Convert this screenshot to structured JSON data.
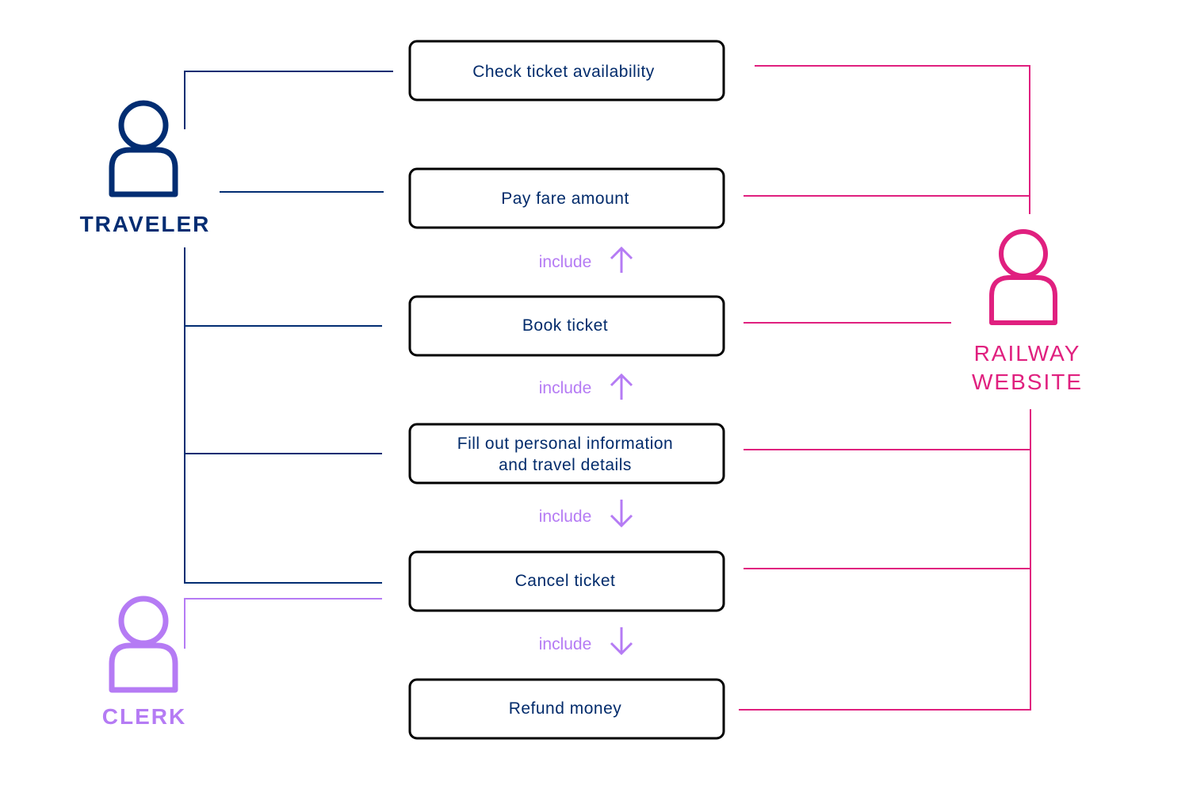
{
  "colors": {
    "traveler": "#022d72",
    "railway": "#e0207f",
    "clerk": "#b57bf4",
    "box_border": "#000000"
  },
  "actors": {
    "traveler": {
      "label": "TRAVELER",
      "icon": "person-icon"
    },
    "clerk": {
      "label": "CLERK",
      "icon": "person-icon"
    },
    "railway": {
      "label_line1": "RAILWAY",
      "label_line2": "WEBSITE",
      "icon": "person-icon"
    }
  },
  "use_cases": [
    {
      "label": "Check ticket availability"
    },
    {
      "label": "Pay fare amount"
    },
    {
      "label": "Book ticket"
    },
    {
      "label_line1": "Fill out personal information",
      "label_line2": "and travel details"
    },
    {
      "label": "Cancel ticket"
    },
    {
      "label": "Refund money"
    }
  ],
  "relations": [
    {
      "label": "include",
      "direction": "up",
      "between": "Pay fare amount / Book ticket"
    },
    {
      "label": "include",
      "direction": "up",
      "between": "Book ticket / Fill out personal information"
    },
    {
      "label": "include",
      "direction": "down",
      "between": "Fill out personal information / Cancel ticket"
    },
    {
      "label": "include",
      "direction": "down",
      "between": "Cancel ticket / Refund money"
    }
  ]
}
